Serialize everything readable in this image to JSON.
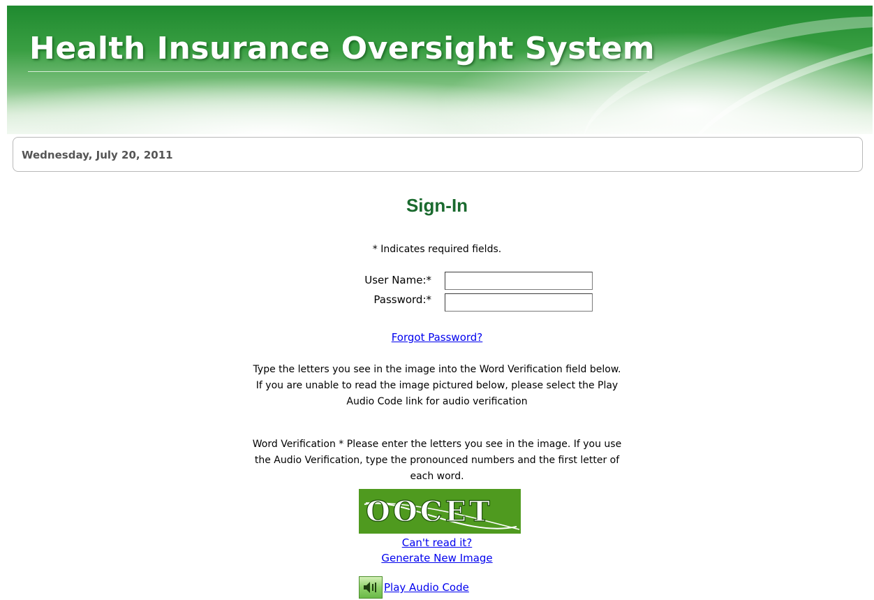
{
  "header": {
    "title": "Health Insurance Oversight System"
  },
  "date_bar": {
    "date": "Wednesday, July 20, 2011"
  },
  "signin": {
    "title": "Sign-In",
    "required_note": "* Indicates required fields.",
    "username_label": "User Name:*",
    "username_value": "",
    "password_label": "Password:*",
    "password_value": "",
    "forgot_password": "Forgot Password?",
    "instructions_image": "Type the letters you see in the image into the Word Verification field below. If you are unable to read the image pictured below, please select the Play Audio Code link for audio verification",
    "instructions_word": "Word Verification * Please enter the letters you see in the image. If you use the Audio Verification, type the pronounced numbers and the first letter of each word.",
    "captcha_text": "OOCET",
    "cant_read": "Can't read it?",
    "generate_new": "Generate New Image",
    "play_audio": "Play Audio Code"
  },
  "colors": {
    "banner_green": "#2e8f3a",
    "signin_title": "#1a6a2e",
    "link": "#0000ee",
    "captcha_bg": "#4f9a1f"
  },
  "icons": {
    "audio": "speaker-icon"
  }
}
